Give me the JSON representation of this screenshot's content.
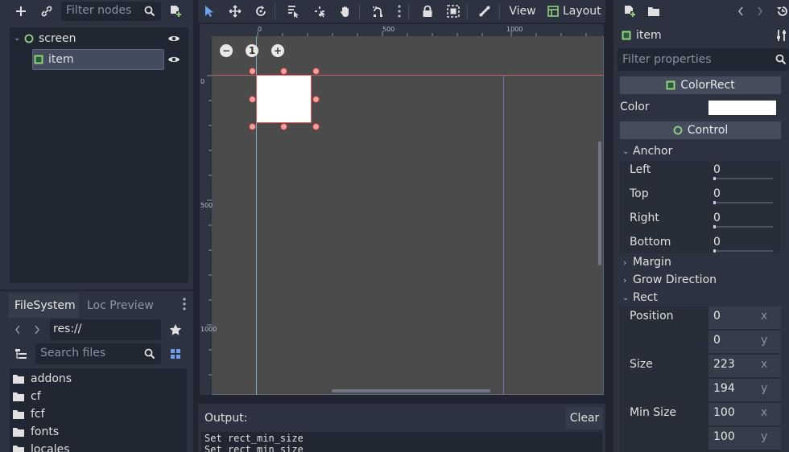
{
  "scene": {
    "filter_placeholder": "Filter nodes",
    "nodes": [
      {
        "label": "screen",
        "type": "Control"
      },
      {
        "label": "item",
        "type": "ColorRect"
      }
    ]
  },
  "filesystem": {
    "tabs": [
      "FileSystem",
      "Loc Preview"
    ],
    "path": "res://",
    "search_placeholder": "Search files",
    "items": [
      "addons",
      "cf",
      "fcf",
      "fonts",
      "locales"
    ]
  },
  "toolbar": {
    "view_label": "View",
    "layout_label": "Layout"
  },
  "viewport": {
    "ruler_top": [
      "0",
      "500",
      "1000"
    ],
    "ruler_left": [
      "0",
      "500",
      "1000"
    ]
  },
  "output": {
    "title": "Output:",
    "clear_label": "Clear",
    "lines": [
      "Set rect_min_size",
      "Set rect_min_size"
    ]
  },
  "inspector": {
    "node_name": "item",
    "filter_placeholder": "Filter properties",
    "colorrect_section": "ColorRect",
    "color_label": "Color",
    "color_value": "#ffffff",
    "control_section": "Control",
    "anchor_group": "Anchor",
    "anchor": [
      {
        "label": "Left",
        "value": "0"
      },
      {
        "label": "Top",
        "value": "0"
      },
      {
        "label": "Right",
        "value": "0"
      },
      {
        "label": "Bottom",
        "value": "0"
      }
    ],
    "margin_group": "Margin",
    "grow_group": "Grow Direction",
    "rect_group": "Rect",
    "position_label": "Position",
    "position": {
      "x": "0",
      "y": "0"
    },
    "size_label": "Size",
    "size": {
      "x": "223",
      "y": "194"
    },
    "min_size_label": "Min Size",
    "min_size": {
      "x": "100",
      "y": "100"
    },
    "axis_x": "x",
    "axis_y": "y"
  },
  "colors": {
    "accent": "#8fcf6f",
    "node_control": "#8fd27f",
    "selection_handle": "#f0a0a0"
  }
}
